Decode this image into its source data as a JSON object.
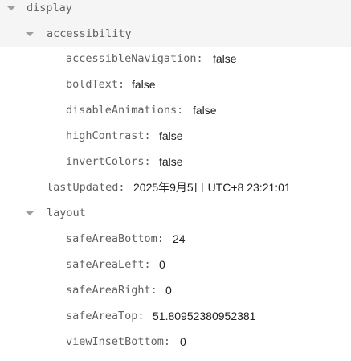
{
  "nodes": {
    "display": {
      "key": "display"
    },
    "accessibility": {
      "key": "accessibility"
    },
    "accessibleNavigation": {
      "key": "accessibleNavigation:",
      "value": "false"
    },
    "boldText": {
      "key": "boldText:",
      "value": "false"
    },
    "disableAnimations": {
      "key": "disableAnimations:",
      "value": "false"
    },
    "highContrast": {
      "key": "highContrast:",
      "value": "false"
    },
    "invertColors": {
      "key": "invertColors:",
      "value": "false"
    },
    "lastUpdated": {
      "key": "lastUpdated:",
      "value": "2025年9月5日 UTC+8 23:21:01"
    },
    "layout": {
      "key": "layout"
    },
    "safeAreaBottom": {
      "key": "safeAreaBottom:",
      "value": "24"
    },
    "safeAreaLeft": {
      "key": "safeAreaLeft:",
      "value": "0"
    },
    "safeAreaRight": {
      "key": "safeAreaRight:",
      "value": "0"
    },
    "safeAreaTop": {
      "key": "safeAreaTop:",
      "value": "51.80952380952381"
    },
    "viewInsetBottom": {
      "key": "viewInsetBottom:",
      "value": "0"
    }
  },
  "icons": {
    "expand": "caret-down-icon"
  },
  "colors": {
    "key": "#616161",
    "value": "#212121",
    "caret": "#9e9e9e",
    "highlight": "#f5f5f5"
  }
}
